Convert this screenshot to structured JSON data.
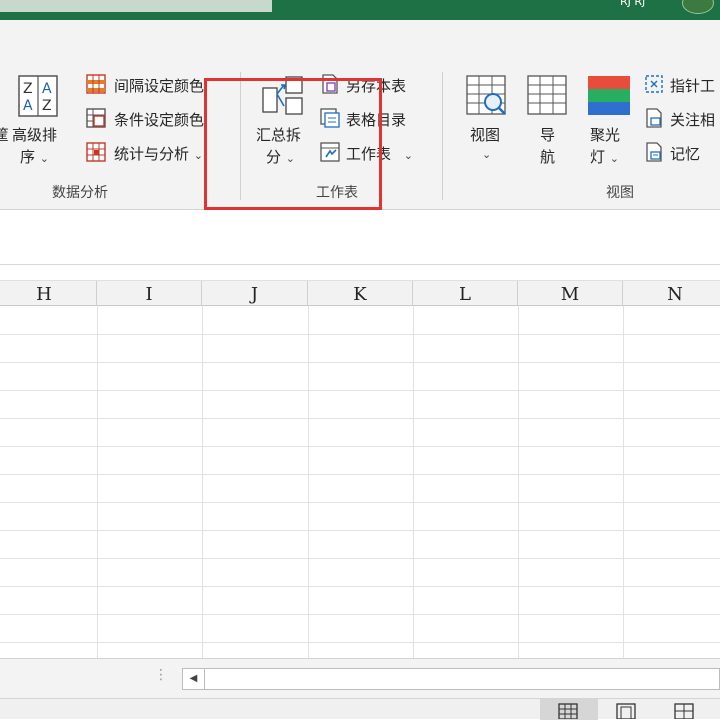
{
  "titlebar": {
    "user_text": "RJ RJ"
  },
  "ribbon": {
    "groups": {
      "data_analysis": {
        "label": "数据分析",
        "sort_button": {
          "line1": "高级排",
          "line2": "序"
        },
        "items": [
          "间隔设定颜色",
          "条件设定颜色",
          "统计与分析"
        ]
      },
      "worksheet": {
        "label": "工作表",
        "split_button": {
          "line1": "汇总拆",
          "line2": "分"
        },
        "items": [
          "另存本表",
          "表格目录",
          "工作表"
        ]
      },
      "view": {
        "label": "视图",
        "buttons": [
          {
            "line1": "视图",
            "line2": ""
          },
          {
            "line1": "导",
            "line2": "航"
          },
          {
            "line1": "聚光",
            "line2": "灯"
          }
        ],
        "items": [
          "指针工",
          "关注相",
          "记忆"
        ]
      }
    },
    "left_cut_char": "筐"
  },
  "columns": [
    "H",
    "I",
    "J",
    "K",
    "L",
    "M",
    "N"
  ],
  "colors": {
    "title_green": "#1e7145",
    "highlight_red": "#e23232"
  }
}
